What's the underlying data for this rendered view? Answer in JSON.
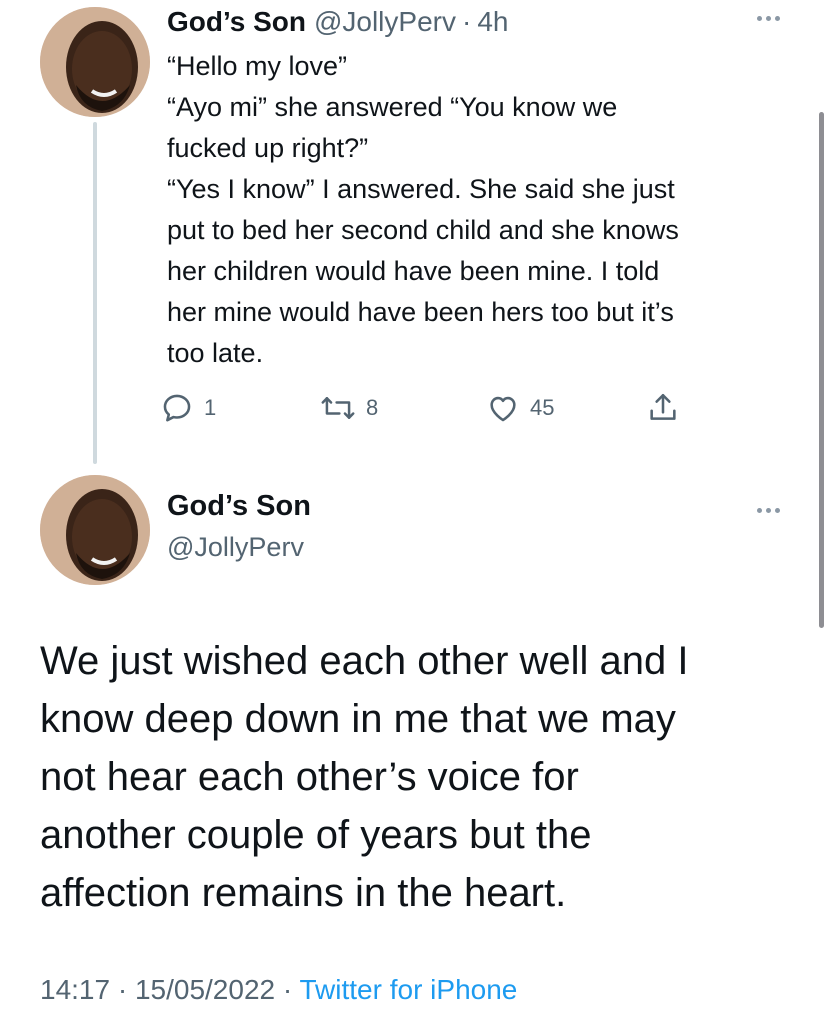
{
  "reply_tweet": {
    "display_name": "God’s Son",
    "handle": "@JollyPerv",
    "separator": "·",
    "time_ago": "4h",
    "text_lines": [
      "“Hello my love”",
      "“Ayo mi” she answered “You know we",
      "fucked up right?”",
      "“Yes I know” I answered. She said she just",
      "put to bed her second child and she knows",
      "her children would have been mine. I told",
      "her mine would have been hers too but it’s",
      "too late."
    ],
    "replies": "1",
    "retweets": "8",
    "likes": "45"
  },
  "main_tweet": {
    "display_name": "God’s Son",
    "handle": "@JollyPerv",
    "text_lines": [
      "We just wished each other well and I",
      "know deep down in me that we may",
      "not hear each other’s voice for",
      "another couple of years but the",
      "affection remains in the heart."
    ],
    "timestamp": "14:17 · 15/05/2022 ·",
    "source": "Twitter for iPhone"
  },
  "icons": [
    "avatar",
    "more-icon",
    "reply-icon",
    "retweet-icon",
    "like-icon",
    "share-icon"
  ],
  "colors": {
    "text": "#0f1419",
    "secondary": "#536471",
    "link": "#1d9bf0",
    "thread_line": "#cfd9de"
  }
}
